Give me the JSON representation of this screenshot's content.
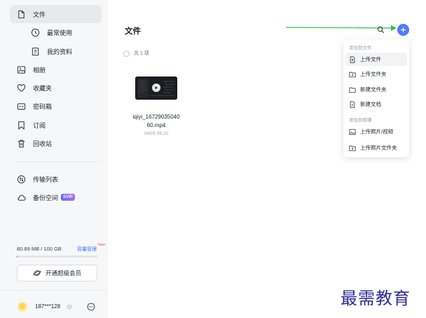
{
  "sidebar": {
    "items": [
      {
        "label": "文件",
        "icon": "file-icon"
      },
      {
        "label": "最常使用",
        "icon": "clock-icon"
      },
      {
        "label": "我的资料",
        "icon": "document-icon"
      },
      {
        "label": "相册",
        "icon": "photo-icon"
      },
      {
        "label": "收藏夹",
        "icon": "heart-icon"
      },
      {
        "label": "密码箱",
        "icon": "safe-icon"
      },
      {
        "label": "订阅",
        "icon": "bookmark-icon"
      },
      {
        "label": "回收站",
        "icon": "trash-icon"
      },
      {
        "label": "传输列表",
        "icon": "transfer-icon"
      },
      {
        "label": "备份空间",
        "icon": "cloud-icon",
        "badge": "SVIP"
      }
    ],
    "storage": {
      "used_text": "80.89 MB / 100 GB",
      "manage_label": "容量管理",
      "new_badge": "New",
      "used_fraction": 0.0008
    },
    "vip_button": "开通超级会员",
    "user": {
      "name": "187***128"
    }
  },
  "main": {
    "title": "文件",
    "count_text": "共 1 项",
    "files": [
      {
        "name": "iqiyi_16729035040 60.mp4",
        "date": "04/05 09:20",
        "type": "video"
      }
    ]
  },
  "dropdown": {
    "section1_title": "添加到文件",
    "section1_items": [
      "上传文件",
      "上传文件夹",
      "新建文件夹",
      "新建文档"
    ],
    "section2_title": "添加到相簿",
    "section2_items": [
      "上传照片/视频",
      "上传照片文件夹"
    ]
  },
  "watermark": "最需教育",
  "colors": {
    "accent": "#4f7cff",
    "arrow": "#2fbf4a",
    "sidebar_bg": "#f6f7f9"
  }
}
